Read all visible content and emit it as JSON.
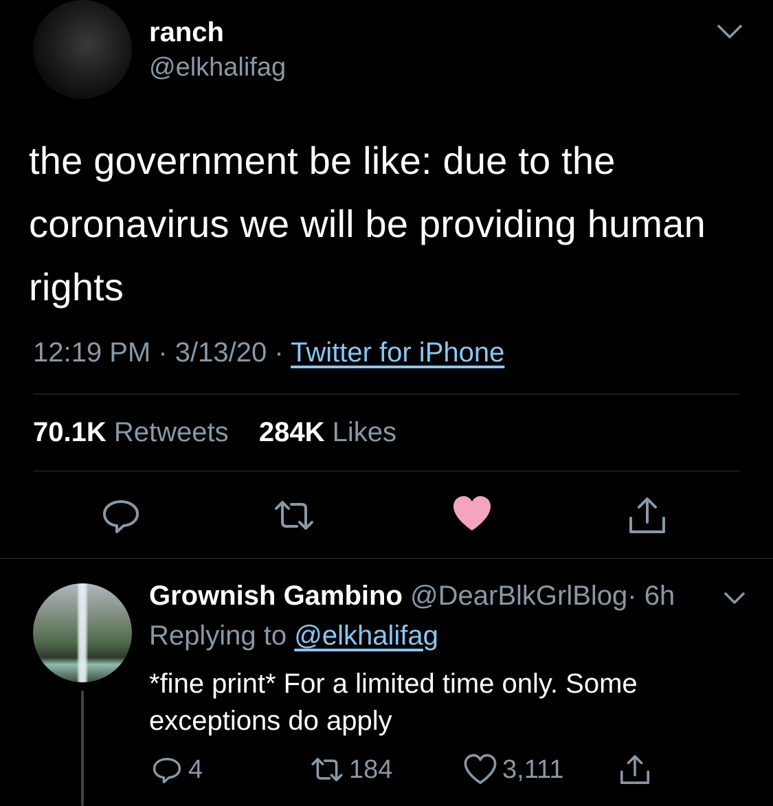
{
  "tweet": {
    "display_name": "ranch",
    "handle": "@elkhalifag",
    "text": "the government be like: due to the coronavirus we will be providing human rights",
    "time": "12:19 PM",
    "separator": "·",
    "date": "3/13/20",
    "source": "Twitter for iPhone",
    "retweets_count": "70.1K",
    "retweets_label": "Retweets",
    "likes_count": "284K",
    "likes_label": "Likes",
    "liked": true
  },
  "reply": {
    "display_name": "Grownish Gambino",
    "handle": "@DearBlkGrlBlog",
    "separator": "·",
    "age": "6h",
    "replying_prefix": "Replying to",
    "replying_to": "@elkhalifag",
    "text": "*fine print* For a limited time only. Some exceptions do apply",
    "reply_count": "4",
    "retweet_count": "184",
    "like_count": "3,111"
  },
  "colors": {
    "background": "#000000",
    "text_primary": "#ffffff",
    "text_secondary": "#8899a6",
    "link": "#8ac7f5",
    "like_active": "#f4a4c0",
    "divider": "#2f3336"
  },
  "icons": {
    "reply": "reply-icon",
    "retweet": "retweet-icon",
    "like": "heart-icon",
    "share": "share-icon",
    "chevron": "chevron-down-icon"
  }
}
